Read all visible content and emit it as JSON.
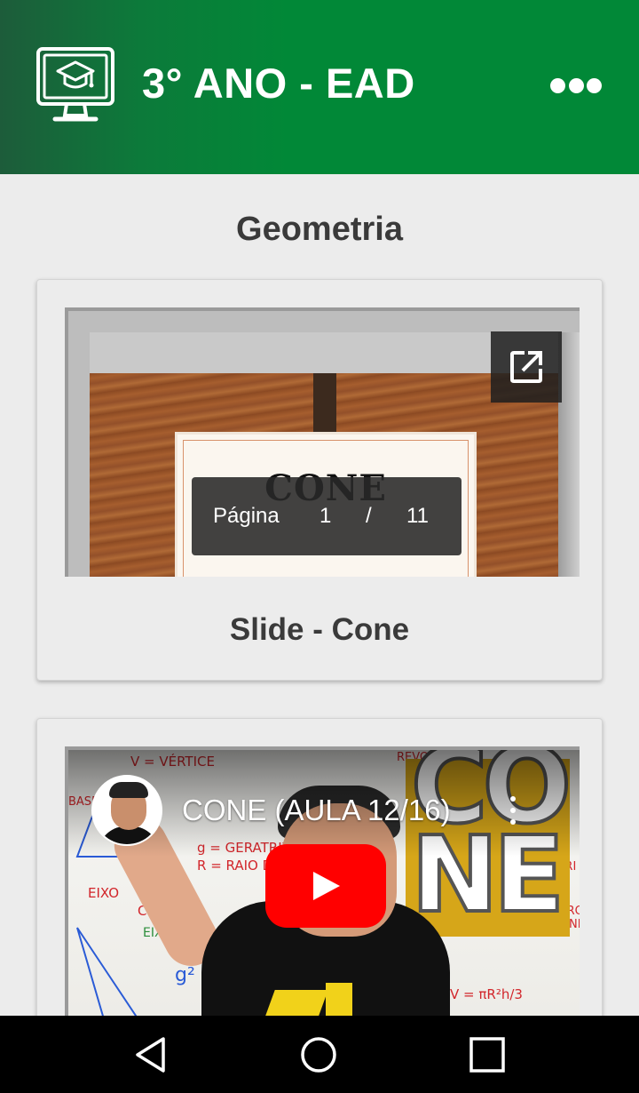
{
  "app": {
    "title": "3° ANO - EAD",
    "icon": "graduation-monitor-icon",
    "menu_icon": "more-horizontal-icon",
    "header_color": "#018837"
  },
  "section": {
    "title": "Geometria"
  },
  "cards": [
    {
      "kind": "slide",
      "caption": "Slide - Cone",
      "slide_word": "CONE",
      "open_icon": "open-in-new-icon",
      "pager": {
        "label": "Página",
        "current": "1",
        "separator": "/",
        "total": "11"
      }
    },
    {
      "kind": "video",
      "video_title": "CONE (AULA 12/16)",
      "play_icon": "youtube-play-icon",
      "menu_icon": "kebab-icon",
      "thumbnail_logo": "CO NE"
    }
  ],
  "navbar": {
    "back_icon": "back-triangle-icon",
    "home_icon": "home-circle-icon",
    "recents_icon": "recents-square-icon"
  }
}
